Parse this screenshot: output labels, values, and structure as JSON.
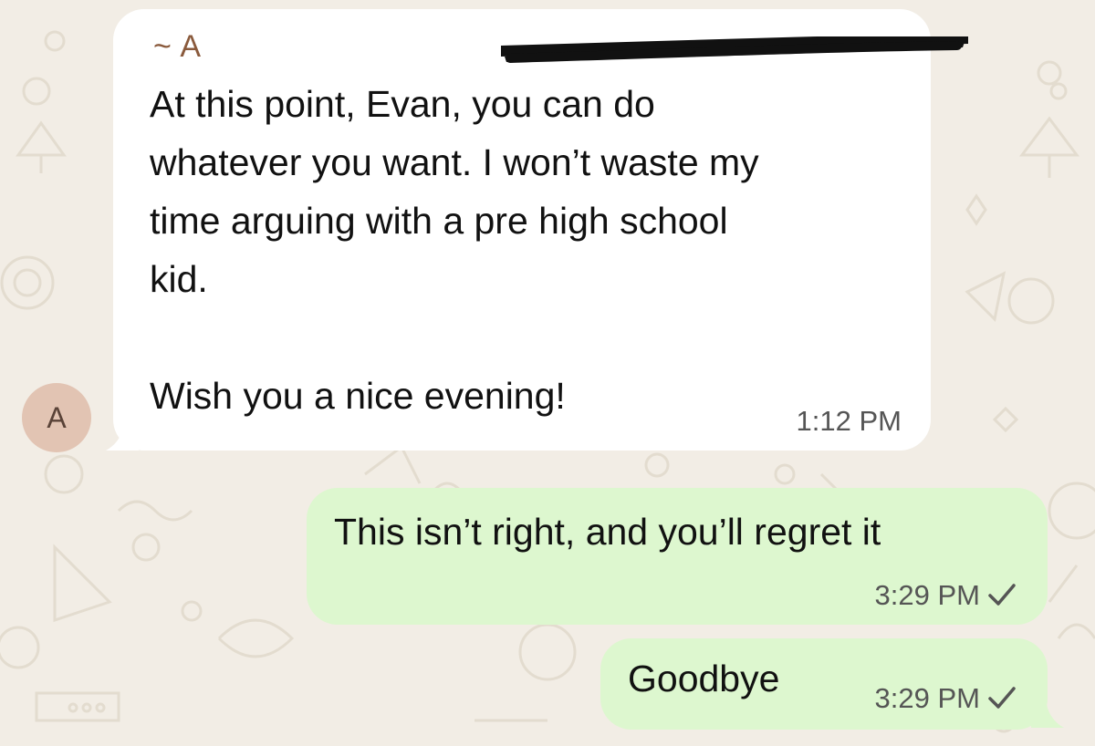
{
  "chat": {
    "incoming": {
      "sender": "~ A",
      "text": "At this point, Evan, you can do\nwhatever you want. I won’t waste my\ntime arguing with a pre high school\nkid.\n\nWish you a nice evening!",
      "time": "1:12 PM",
      "avatar_initial": "A"
    },
    "outgoing": [
      {
        "text": "This isn’t right, and you’ll regret it",
        "time": "3:29 PM",
        "status": "sent-check-icon"
      },
      {
        "text": "Goodbye",
        "time": "3:29 PM",
        "status": "sent-check-icon"
      }
    ]
  },
  "colors": {
    "background": "#f2ede5",
    "incoming_bubble": "#ffffff",
    "outgoing_bubble": "#ddf7cf",
    "sender_name": "#8a5a3c",
    "avatar": "#e2c4b3"
  }
}
